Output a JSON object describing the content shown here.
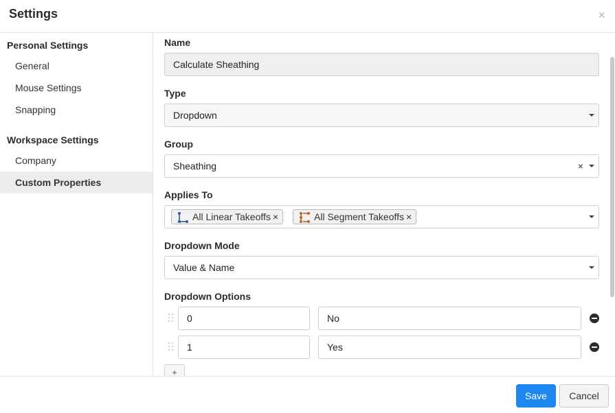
{
  "dialog": {
    "title": "Settings",
    "close_glyph": "×"
  },
  "sidebar": {
    "sections": [
      {
        "heading": "Personal Settings",
        "items": [
          "General",
          "Mouse Settings",
          "Snapping"
        ]
      },
      {
        "heading": "Workspace Settings",
        "items": [
          "Company",
          "Custom Properties"
        ]
      }
    ],
    "active_item": "Custom Properties"
  },
  "form": {
    "name": {
      "label": "Name",
      "value": "Calculate Sheathing"
    },
    "type": {
      "label": "Type",
      "value": "Dropdown"
    },
    "group": {
      "label": "Group",
      "value": "Sheathing",
      "clear_glyph": "×"
    },
    "applies_to": {
      "label": "Applies To",
      "tags": [
        {
          "label": "All Linear Takeoffs",
          "icon": "linear-takeoff-icon",
          "color": "#2c5aa0",
          "remove_glyph": "×"
        },
        {
          "label": "All Segment Takeoffs",
          "icon": "segment-takeoff-icon",
          "color": "#b5652a",
          "remove_glyph": "×"
        }
      ]
    },
    "dropdown_mode": {
      "label": "Dropdown Mode",
      "value": "Value & Name"
    },
    "dropdown_options": {
      "label": "Dropdown Options",
      "rows": [
        {
          "value": "0",
          "name": "No"
        },
        {
          "value": "1",
          "name": "Yes"
        }
      ],
      "add_glyph": "+"
    }
  },
  "footer": {
    "save_label": "Save",
    "cancel_label": "Cancel"
  },
  "colors": {
    "primary": "#1e88f0",
    "active_bg": "#ececec",
    "border": "#cfcfcf"
  }
}
